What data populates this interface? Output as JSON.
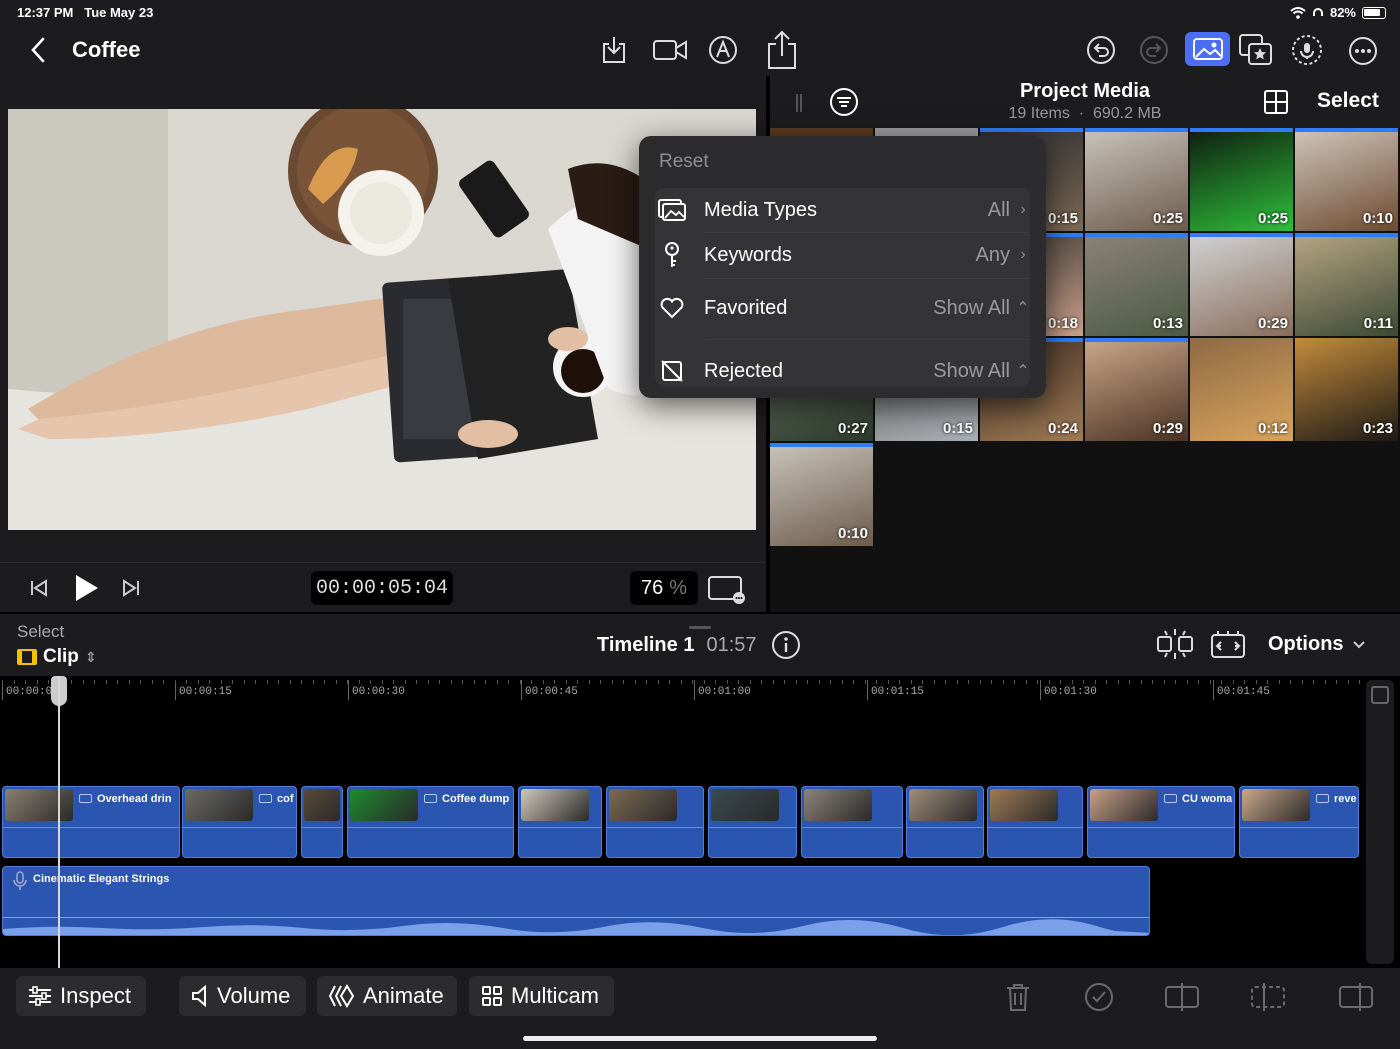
{
  "status": {
    "time": "12:37 PM",
    "date": "Tue May 23",
    "battery": "82%"
  },
  "header": {
    "title": "Coffee"
  },
  "viewer": {
    "timecode": "00:00:05:04",
    "zoom_value": "76",
    "zoom_unit": "%"
  },
  "media": {
    "title": "Project Media",
    "count": "19 Items",
    "size": "690.2 MB",
    "select_label": "Select",
    "durations": [
      "0:15",
      "0:25",
      "0:25",
      "0:10",
      "0:18",
      "0:13",
      "0:29",
      "0:11",
      "0:27",
      "0:15",
      "0:24",
      "0:29",
      "0:12",
      "0:23",
      "0:10"
    ]
  },
  "filter": {
    "reset": "Reset",
    "rows": [
      {
        "label": "Media Types",
        "value": "All"
      },
      {
        "label": "Keywords",
        "value": "Any"
      },
      {
        "label": "Favorited",
        "value": "Show All"
      },
      {
        "label": "Rejected",
        "value": "Show All"
      }
    ]
  },
  "timeline": {
    "select_label": "Select",
    "mode": "Clip",
    "name": "Timeline 1",
    "duration": "01:57",
    "options": "Options",
    "ticks": [
      "00:00:00",
      "00:00:15",
      "00:00:30",
      "00:00:45",
      "00:01:00",
      "00:01:15",
      "00:01:30",
      "00:01:45"
    ],
    "clips": [
      "Overhead drin",
      "cof",
      "",
      "Coffee dump",
      "",
      "",
      "",
      "",
      "",
      "",
      "",
      "CU woma",
      "reve"
    ],
    "audio": "Cinematic Elegant Strings"
  },
  "toolbar": {
    "inspect": "Inspect",
    "volume": "Volume",
    "animate": "Animate",
    "multicam": "Multicam"
  },
  "colors": {
    "accent": "#2f7cf6",
    "clip": "#2a55b0",
    "panel": "#1c1c1e"
  }
}
